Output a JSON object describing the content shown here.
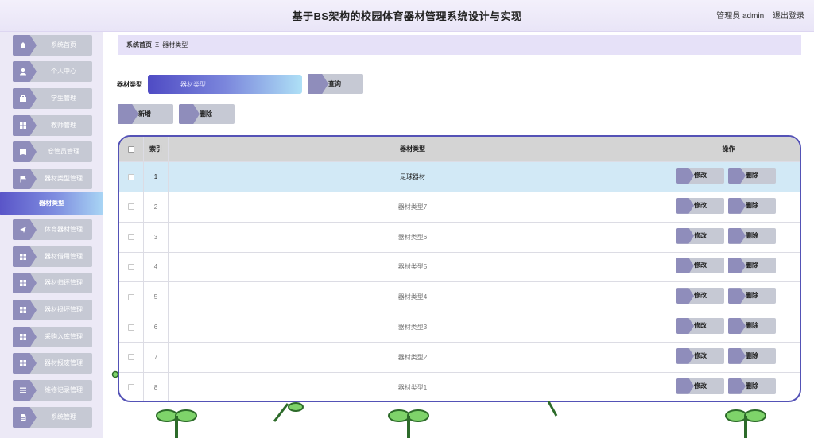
{
  "header": {
    "title": "基于BS架构的校园体育器材管理系统设计与实现",
    "user_label": "管理员 admin",
    "logout_label": "退出登录"
  },
  "sidebar": {
    "items": [
      {
        "label": "系统首页",
        "icon": "home-icon"
      },
      {
        "label": "个人中心",
        "icon": "user-icon"
      },
      {
        "label": "学生管理",
        "icon": "briefcase-icon"
      },
      {
        "label": "教师管理",
        "icon": "grid-icon"
      },
      {
        "label": "仓管员管理",
        "icon": "book-icon"
      },
      {
        "label": "器材类型管理",
        "icon": "flag-icon"
      },
      {
        "label": "器材类型",
        "icon": ""
      },
      {
        "label": "体育器材管理",
        "icon": "send-icon"
      },
      {
        "label": "器材借用管理",
        "icon": "grid-icon"
      },
      {
        "label": "器材归还管理",
        "icon": "grid-icon"
      },
      {
        "label": "器材损坏管理",
        "icon": "grid-icon"
      },
      {
        "label": "采购入库管理",
        "icon": "grid-icon"
      },
      {
        "label": "器材报废管理",
        "icon": "grid-icon"
      },
      {
        "label": "维修记录管理",
        "icon": "list-icon"
      },
      {
        "label": "系统管理",
        "icon": "doc-icon"
      }
    ]
  },
  "breadcrumb": {
    "home": "系统首页",
    "separator": "Ξ",
    "current": "器材类型"
  },
  "search": {
    "label": "器材类型",
    "placeholder": "器材类型",
    "query_label": "查询"
  },
  "actions": {
    "add_label": "新增",
    "delete_label": "删除"
  },
  "table": {
    "headers": {
      "index": "索引",
      "type": "器材类型",
      "ops": "操作"
    },
    "edit_label": "修改",
    "delete_label": "删除",
    "rows": [
      {
        "index": "1",
        "type": "足球器材"
      },
      {
        "index": "2",
        "type": "器材类型7"
      },
      {
        "index": "3",
        "type": "器材类型6"
      },
      {
        "index": "4",
        "type": "器材类型5"
      },
      {
        "index": "5",
        "type": "器材类型4"
      },
      {
        "index": "6",
        "type": "器材类型3"
      },
      {
        "index": "7",
        "type": "器材类型2"
      },
      {
        "index": "8",
        "type": "器材类型1"
      }
    ]
  },
  "colors": {
    "accent": "#5452b6",
    "tag": "#8f8dbb",
    "button": "#c6c9d4",
    "selected_row": "#d2e9f6"
  }
}
